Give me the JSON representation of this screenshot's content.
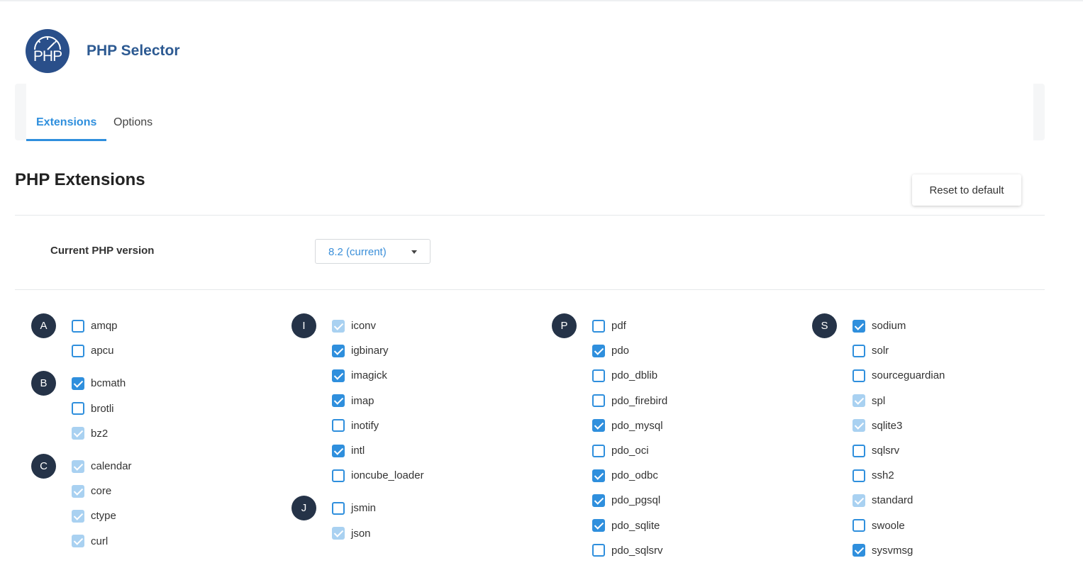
{
  "app": {
    "title": "PHP Selector",
    "logo_text": "PHP",
    "brand_color": "#2a4f8a",
    "accent_color": "#2f8fdd"
  },
  "tabs": [
    {
      "label": "Extensions",
      "active": true
    },
    {
      "label": "Options",
      "active": false
    }
  ],
  "section": {
    "title": "PHP Extensions",
    "reset_label": "Reset to default"
  },
  "version": {
    "label": "Current PHP version",
    "selected": "8.2 (current)"
  },
  "columns": [
    {
      "groups": [
        {
          "letter": "A",
          "items": [
            {
              "name": "amqp",
              "state": "unchecked"
            },
            {
              "name": "apcu",
              "state": "unchecked"
            }
          ]
        },
        {
          "letter": "B",
          "items": [
            {
              "name": "bcmath",
              "state": "checked"
            },
            {
              "name": "brotli",
              "state": "unchecked"
            },
            {
              "name": "bz2",
              "state": "disabled"
            }
          ]
        },
        {
          "letter": "C",
          "items": [
            {
              "name": "calendar",
              "state": "disabled"
            },
            {
              "name": "core",
              "state": "disabled"
            },
            {
              "name": "ctype",
              "state": "disabled"
            },
            {
              "name": "curl",
              "state": "disabled"
            }
          ]
        }
      ]
    },
    {
      "groups": [
        {
          "letter": "I",
          "items": [
            {
              "name": "iconv",
              "state": "disabled"
            },
            {
              "name": "igbinary",
              "state": "checked"
            },
            {
              "name": "imagick",
              "state": "checked"
            },
            {
              "name": "imap",
              "state": "checked"
            },
            {
              "name": "inotify",
              "state": "unchecked"
            },
            {
              "name": "intl",
              "state": "checked"
            },
            {
              "name": "ioncube_loader",
              "state": "unchecked"
            }
          ]
        },
        {
          "letter": "J",
          "items": [
            {
              "name": "jsmin",
              "state": "unchecked"
            },
            {
              "name": "json",
              "state": "disabled"
            }
          ]
        }
      ]
    },
    {
      "groups": [
        {
          "letter": "P",
          "items": [
            {
              "name": "pdf",
              "state": "unchecked"
            },
            {
              "name": "pdo",
              "state": "checked"
            },
            {
              "name": "pdo_dblib",
              "state": "unchecked"
            },
            {
              "name": "pdo_firebird",
              "state": "unchecked"
            },
            {
              "name": "pdo_mysql",
              "state": "checked"
            },
            {
              "name": "pdo_oci",
              "state": "unchecked"
            },
            {
              "name": "pdo_odbc",
              "state": "checked"
            },
            {
              "name": "pdo_pgsql",
              "state": "checked"
            },
            {
              "name": "pdo_sqlite",
              "state": "checked"
            },
            {
              "name": "pdo_sqlsrv",
              "state": "unchecked"
            }
          ]
        }
      ]
    },
    {
      "groups": [
        {
          "letter": "S",
          "items": [
            {
              "name": "sodium",
              "state": "checked"
            },
            {
              "name": "solr",
              "state": "unchecked"
            },
            {
              "name": "sourceguardian",
              "state": "unchecked"
            },
            {
              "name": "spl",
              "state": "disabled"
            },
            {
              "name": "sqlite3",
              "state": "disabled"
            },
            {
              "name": "sqlsrv",
              "state": "unchecked"
            },
            {
              "name": "ssh2",
              "state": "unchecked"
            },
            {
              "name": "standard",
              "state": "disabled"
            },
            {
              "name": "swoole",
              "state": "unchecked"
            },
            {
              "name": "sysvmsg",
              "state": "checked"
            }
          ]
        }
      ]
    }
  ]
}
